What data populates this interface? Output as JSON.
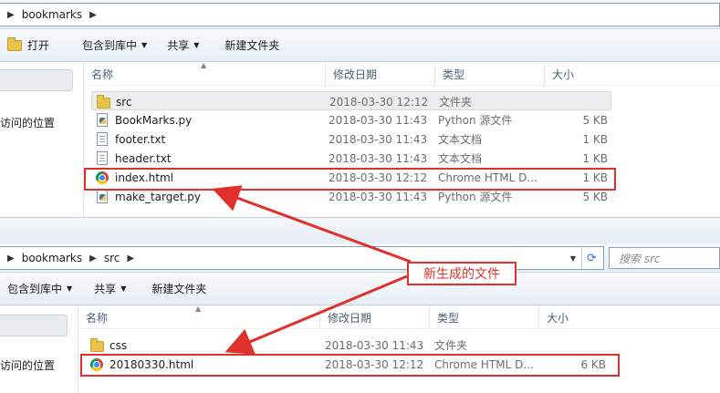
{
  "colors": {
    "annotation": "#e0302c",
    "folder": "#e8c24a"
  },
  "top_window": {
    "breadcrumb": [
      "bookmarks"
    ],
    "toolbar": {
      "open": "打开",
      "include_library": "包含到库中",
      "share": "共享",
      "new_folder": "新建文件夹"
    },
    "nav_text": "访问的位置",
    "columns": {
      "name": "名称",
      "modified": "修改日期",
      "type": "类型",
      "size": "大小"
    },
    "files": [
      {
        "name": "src",
        "modified": "2018-03-30 12:12",
        "type": "文件夹",
        "size": "",
        "icon": "folder-icon",
        "selected": true
      },
      {
        "name": "BookMarks.py",
        "modified": "2018-03-30 11:43",
        "type": "Python 源文件",
        "size": "5 KB",
        "icon": "python-file-icon"
      },
      {
        "name": "footer.txt",
        "modified": "2018-03-30 11:43",
        "type": "文本文档",
        "size": "1 KB",
        "icon": "text-file-icon"
      },
      {
        "name": "header.txt",
        "modified": "2018-03-30 11:43",
        "type": "文本文档",
        "size": "1 KB",
        "icon": "text-file-icon"
      },
      {
        "name": "index.html",
        "modified": "2018-03-30 12:12",
        "type": "Chrome HTML D...",
        "size": "1 KB",
        "icon": "chrome-html-icon",
        "highlighted": true
      },
      {
        "name": "make_target.py",
        "modified": "2018-03-30 11:43",
        "type": "Python 源文件",
        "size": "5 KB",
        "icon": "python-file-icon"
      }
    ]
  },
  "bottom_window": {
    "breadcrumb": [
      "bookmarks",
      "src"
    ],
    "search_placeholder": "搜索 src",
    "toolbar": {
      "include_library": "包含到库中",
      "share": "共享",
      "new_folder": "新建文件夹"
    },
    "nav_text": "访问的位置",
    "columns": {
      "name": "名称",
      "modified": "修改日期",
      "type": "类型",
      "size": "大小"
    },
    "files": [
      {
        "name": "css",
        "modified": "2018-03-30 11:43",
        "type": "文件夹",
        "size": "",
        "icon": "folder-icon"
      },
      {
        "name": "20180330.html",
        "modified": "2018-03-30 12:12",
        "type": "Chrome HTML D...",
        "size": "6 KB",
        "icon": "chrome-html-icon",
        "highlighted": true
      }
    ]
  },
  "annotation": {
    "label": "新生成的文件"
  }
}
